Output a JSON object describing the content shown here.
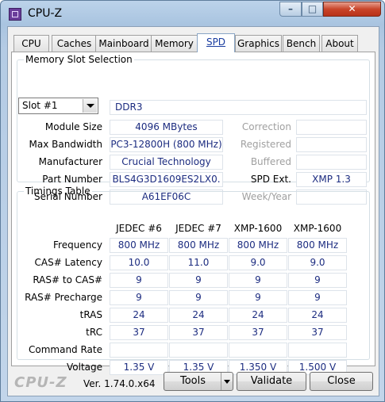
{
  "window": {
    "title": "CPU-Z",
    "min_label": "–",
    "max_label": "□",
    "close_label": "✕"
  },
  "tabs": [
    "CPU",
    "Caches",
    "Mainboard",
    "Memory",
    "SPD",
    "Graphics",
    "Bench",
    "About"
  ],
  "active_tab": "SPD",
  "slot": {
    "legend": "Memory Slot Selection",
    "selected_slot": "Slot #1",
    "memory_type": "DDR3",
    "labels": {
      "module_size": "Module Size",
      "max_bandwidth": "Max Bandwidth",
      "manufacturer": "Manufacturer",
      "part_number": "Part Number",
      "serial_number": "Serial Number",
      "correction": "Correction",
      "registered": "Registered",
      "buffered": "Buffered",
      "spd_ext": "SPD Ext.",
      "week_year": "Week/Year"
    },
    "values": {
      "module_size": "4096 MBytes",
      "max_bandwidth": "PC3-12800H (800 MHz)",
      "manufacturer": "Crucial Technology",
      "part_number": "BLS4G3D1609ES2LX0.",
      "serial_number": "A61EF06C",
      "correction": "",
      "registered": "",
      "buffered": "",
      "spd_ext": "XMP 1.3",
      "week_year": ""
    }
  },
  "timings": {
    "legend": "Timings Table",
    "columns": [
      "JEDEC #6",
      "JEDEC #7",
      "XMP-1600",
      "XMP-1600"
    ],
    "rows": [
      {
        "label": "Frequency",
        "values": [
          "800 MHz",
          "800 MHz",
          "800 MHz",
          "800 MHz"
        ]
      },
      {
        "label": "CAS# Latency",
        "values": [
          "10.0",
          "11.0",
          "9.0",
          "9.0"
        ]
      },
      {
        "label": "RAS# to CAS#",
        "values": [
          "9",
          "9",
          "9",
          "9"
        ]
      },
      {
        "label": "RAS# Precharge",
        "values": [
          "9",
          "9",
          "9",
          "9"
        ]
      },
      {
        "label": "tRAS",
        "values": [
          "24",
          "24",
          "24",
          "24"
        ]
      },
      {
        "label": "tRC",
        "values": [
          "37",
          "37",
          "37",
          "37"
        ]
      },
      {
        "label": "Command Rate",
        "values": [
          "",
          "",
          "",
          ""
        ]
      },
      {
        "label": "Voltage",
        "values": [
          "1.35 V",
          "1.35 V",
          "1.350 V",
          "1.500 V"
        ]
      }
    ]
  },
  "footer": {
    "logo": "CPU-Z",
    "version": "Ver. 1.74.0.x64",
    "tools_label": "Tools",
    "validate_label": "Validate",
    "close_label": "Close"
  }
}
